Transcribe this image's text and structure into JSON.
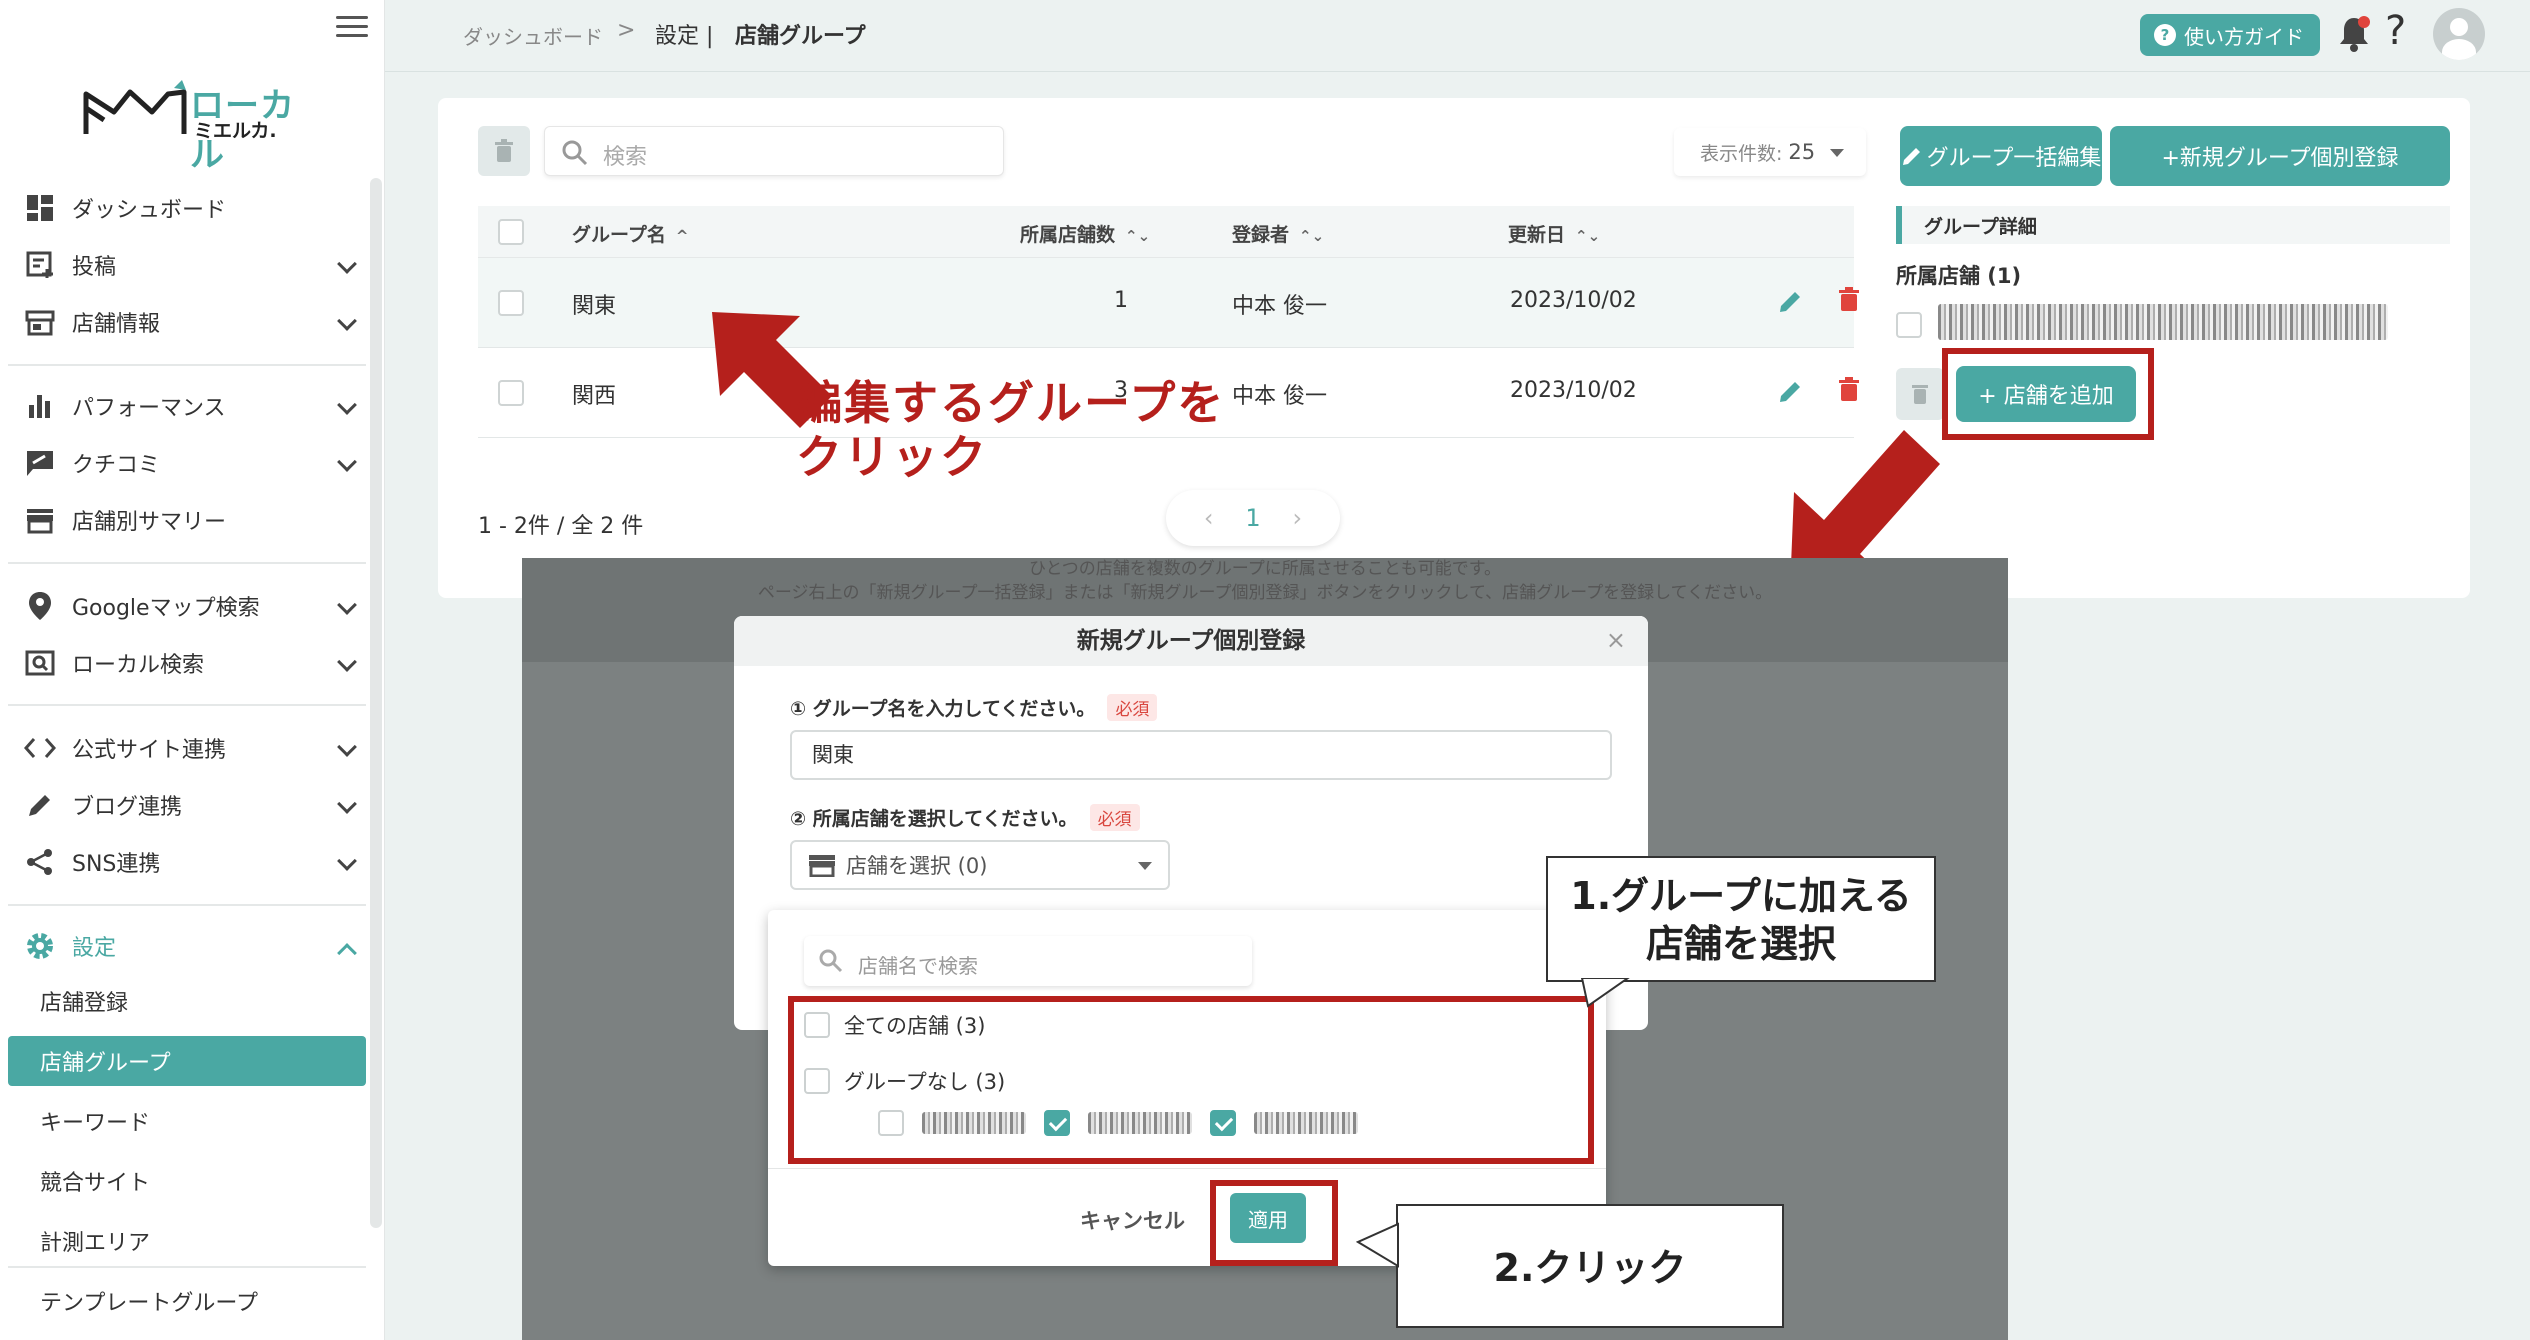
{
  "sidebar": {
    "logo_main": "ローカル",
    "logo_sub": "ミエルカ.",
    "items": [
      {
        "label": "ダッシュボード"
      },
      {
        "label": "投稿"
      },
      {
        "label": "店舗情報"
      },
      {
        "label": "パフォーマンス"
      },
      {
        "label": "クチコミ"
      },
      {
        "label": "店舗別サマリー"
      },
      {
        "label": "Googleマップ検索"
      },
      {
        "label": "ローカル検索"
      },
      {
        "label": "公式サイト連携"
      },
      {
        "label": "ブログ連携"
      },
      {
        "label": "SNS連携"
      },
      {
        "label": "設定"
      }
    ],
    "sub_items": [
      {
        "label": "店舗登録"
      },
      {
        "label": "店舗グループ"
      },
      {
        "label": "キーワード"
      },
      {
        "label": "競合サイト"
      },
      {
        "label": "計測エリア"
      },
      {
        "label": "テンプレートグループ"
      }
    ]
  },
  "topbar": {
    "crumb1": "ダッシュボード",
    "crumb_sep": ">",
    "crumb2": "設定 |",
    "crumb3": "店舗グループ",
    "guide_label": "使い方ガイド",
    "help": "?"
  },
  "toolbar": {
    "search_placeholder": "検索",
    "perpage_label": "表示件数:",
    "perpage_value": "25",
    "bulk_edit_label": "グループ一括編集",
    "new_label": "+新規グループ個別登録"
  },
  "table": {
    "headers": {
      "name": "グループ名",
      "count": "所属店舗数",
      "owner": "登録者",
      "updated": "更新日"
    },
    "sort_up": "^",
    "sort_both": "⌃⌄",
    "rows": [
      {
        "name": "関東",
        "count": "1",
        "owner": "中本 俊一",
        "updated": "2023/10/02"
      },
      {
        "name": "関西",
        "count": "3",
        "owner": "中本 俊一",
        "updated": "2023/10/02"
      }
    ],
    "pager_info": "1 - 2件 / 全 2 件",
    "page": "1",
    "prev": "‹",
    "next": "›"
  },
  "detail": {
    "title": "グループ詳細",
    "sub": "所属店舗 (1)",
    "add_store_label": "+ 店舗を追加"
  },
  "annotations": {
    "edit_group_line1": "編集するグループを",
    "edit_group_line2": "クリック",
    "step1_line1": "1.グループに加える",
    "step1_line2": "店舗を選択",
    "step2": "2.クリック"
  },
  "inset": {
    "note1": "ひとつの店舗を複数のグループに所属させることも可能です。",
    "note2": "ページ右上の「新規グループ一括登録」または「新規グループ個別登録」ボタンをクリックして、店舗グループを登録してください。"
  },
  "modal": {
    "title": "新規グループ個別登録",
    "close": "×",
    "step1_label": "① グループ名を入力してください。",
    "step2_label": "② 所属店舗を選択してください。",
    "required": "必須",
    "name_value": "関東",
    "select_label": "店舗を選択 (0)",
    "dd_search_placeholder": "店舗名で検索",
    "dd_all": "全ての店舗 (3)",
    "dd_nogroup": "グループなし (3)",
    "cancel": "キャンセル",
    "apply": "適用"
  }
}
